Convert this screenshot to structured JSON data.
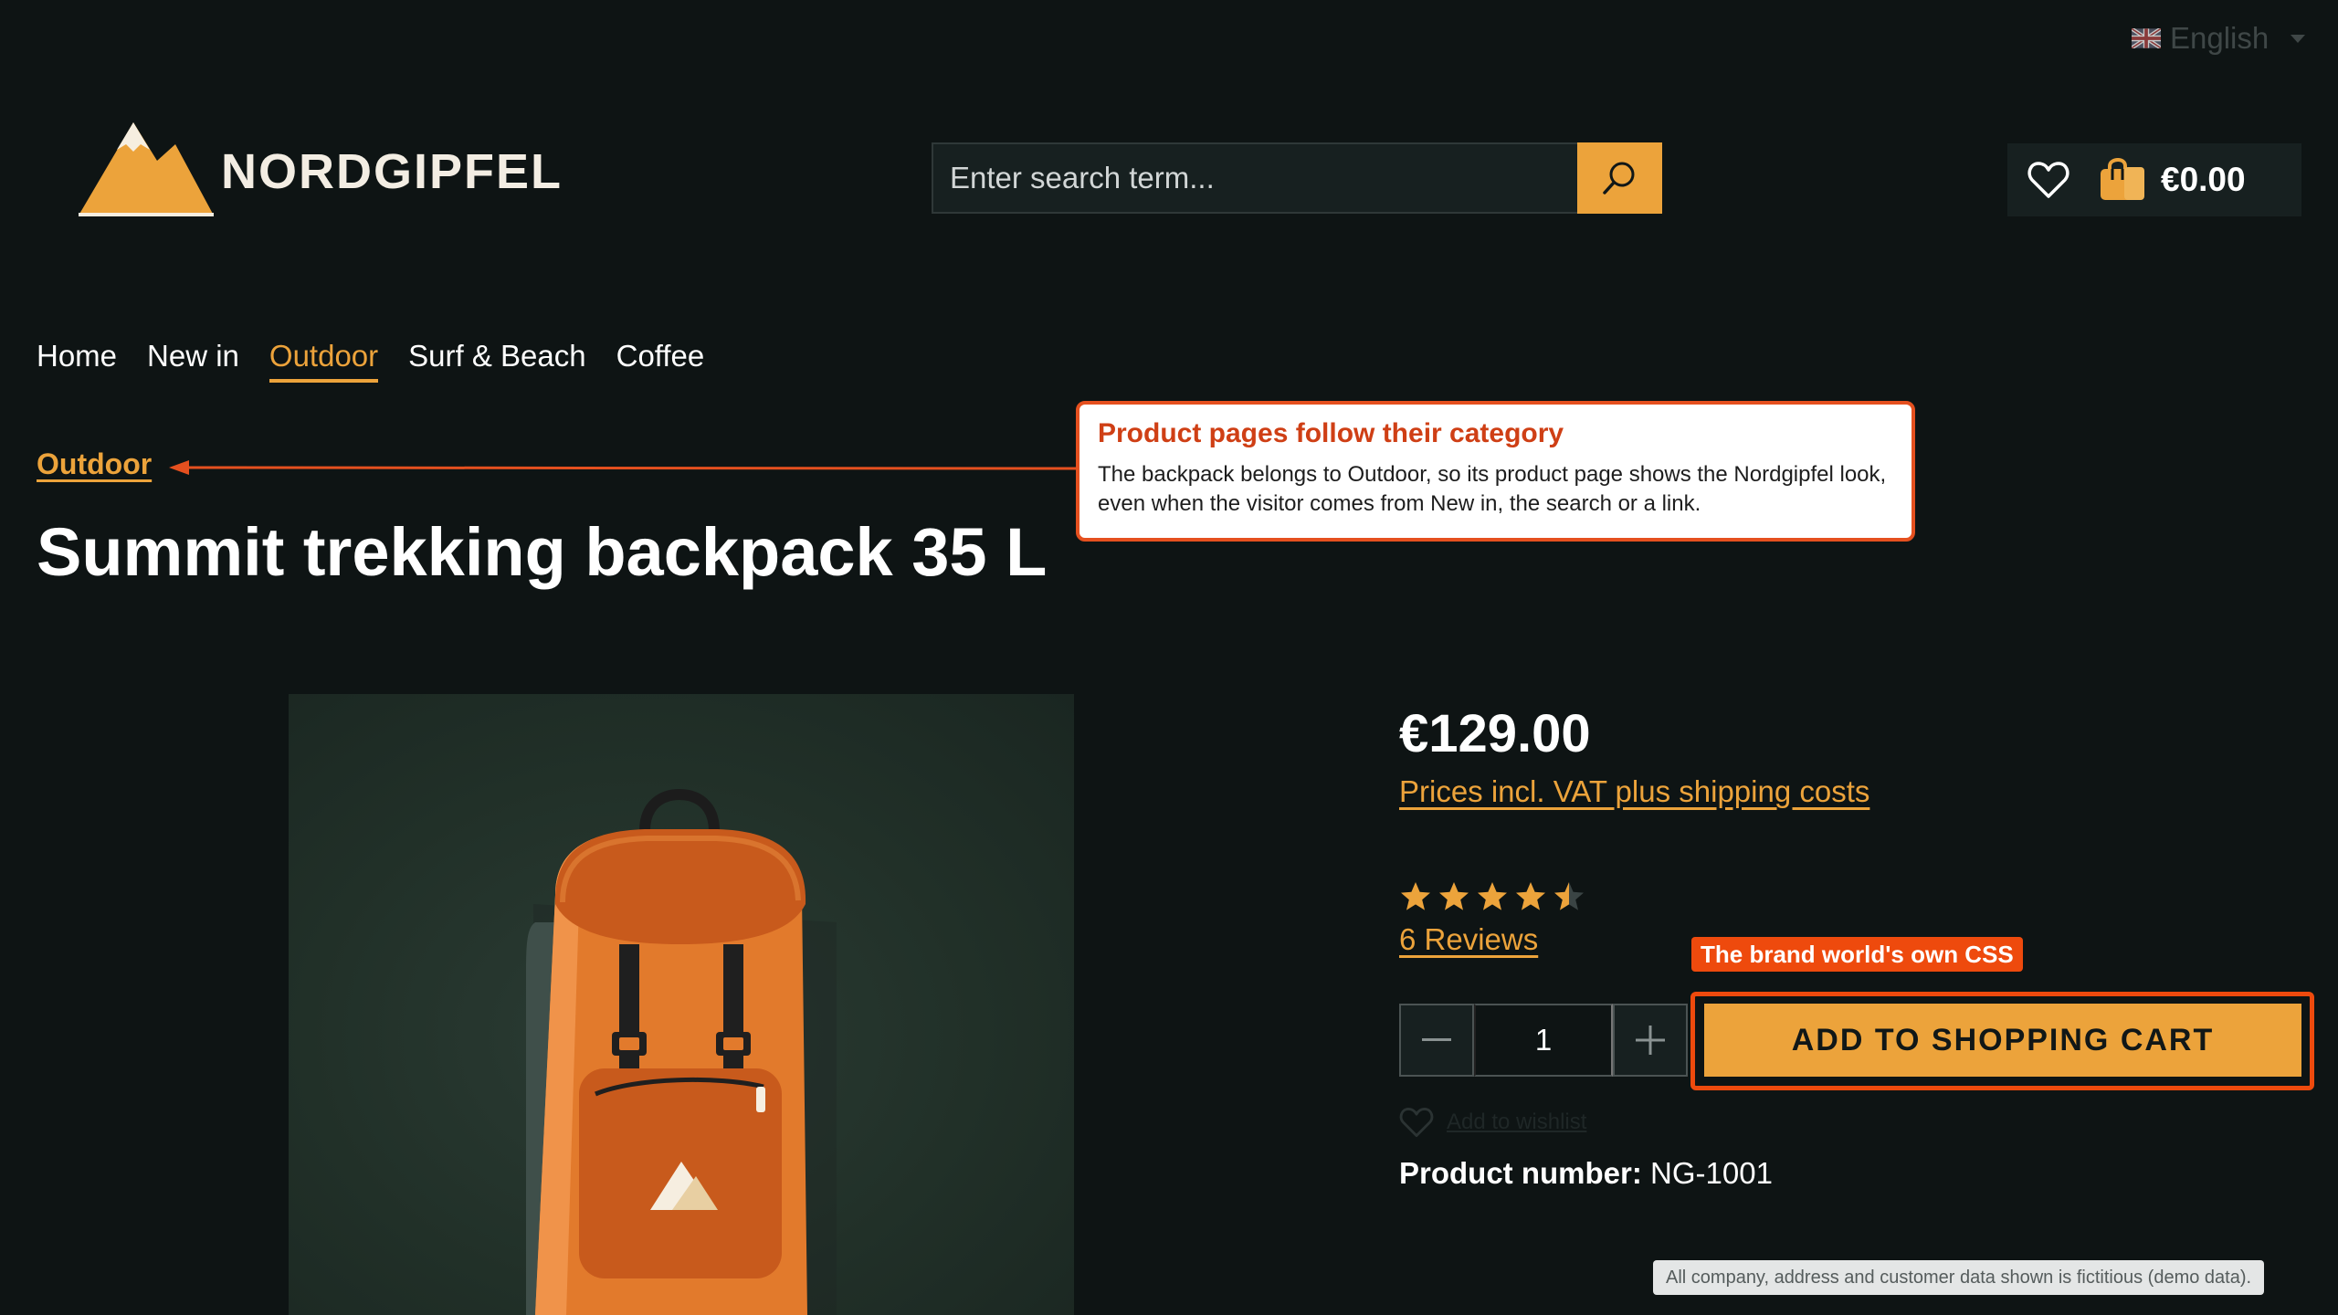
{
  "header": {
    "language": "English",
    "brand": "NORDGIPFEL",
    "search": {
      "placeholder": "Enter search term..."
    },
    "cart_total": "€0.00"
  },
  "nav": {
    "items": [
      {
        "label": "Home"
      },
      {
        "label": "New in"
      },
      {
        "label": "Outdoor",
        "active": true
      },
      {
        "label": "Surf & Beach"
      },
      {
        "label": "Coffee"
      }
    ]
  },
  "breadcrumb": "Outdoor",
  "product": {
    "title": "Summit trekking backpack 35 L",
    "price": "€129.00",
    "vat_note": "Prices incl. VAT plus shipping costs",
    "rating": 4.5,
    "rating_max": 5,
    "reviews": "6 Reviews",
    "quantity": "1",
    "add_to_cart": "ADD TO SHOPPING CART",
    "wishlist_link": "Add to wishlist",
    "number_label": "Product number:",
    "number_value": "NG-1001"
  },
  "annotations": {
    "callout_title": "Product pages follow their category",
    "callout_body": "The backpack belongs to Outdoor, so its product page shows the Nordgipfel look, even when the visitor comes from New in, the search or a link.",
    "badge": "The brand world's own CSS"
  },
  "footer_note": "All company, address and customer data shown is fictitious (demo data).",
  "colors": {
    "accent": "#eca33b",
    "background": "#0e1414",
    "annotation": "#ee4a0d"
  },
  "icons": [
    "uk-flag-icon",
    "mountain-logo-icon",
    "search-icon",
    "heart-icon",
    "shopping-bag-icon",
    "star-icon",
    "minus-icon",
    "plus-icon"
  ]
}
